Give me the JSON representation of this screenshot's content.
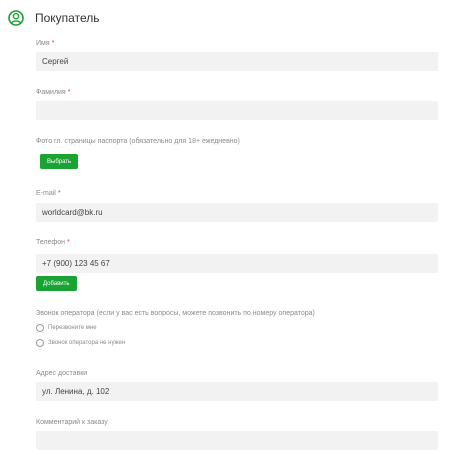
{
  "header": {
    "title": "Покупатель",
    "icon": "user-avatar-icon",
    "accent": "#1aa232"
  },
  "form": {
    "name": {
      "label": "Имя",
      "required": "*",
      "value": "Сергей"
    },
    "surname": {
      "label": "Фамилия",
      "required": "*",
      "value": ""
    },
    "passport": {
      "label": "Фото гл. страницы паспорта (обязательно для 18+ ежедневно)",
      "button": "Выбрать"
    },
    "email": {
      "label": "E-mail",
      "required": "*",
      "value": "worldcard@bk.ru"
    },
    "phone": {
      "label": "Телефон",
      "required": "*",
      "value": "+7 (900) 123 45 67",
      "button": "Добавить"
    },
    "operator_call": {
      "label": "Звонок оператора (если у вас есть вопросы, можете позвонить по номеру оператора)",
      "options": [
        "Перезвоните мне",
        "Звонок оператора не нужен"
      ]
    },
    "address": {
      "label": "Адрес доставки",
      "value": "ул. Ленина, д. 102"
    },
    "comment": {
      "label": "Комментарий к заказу",
      "value": ""
    }
  }
}
